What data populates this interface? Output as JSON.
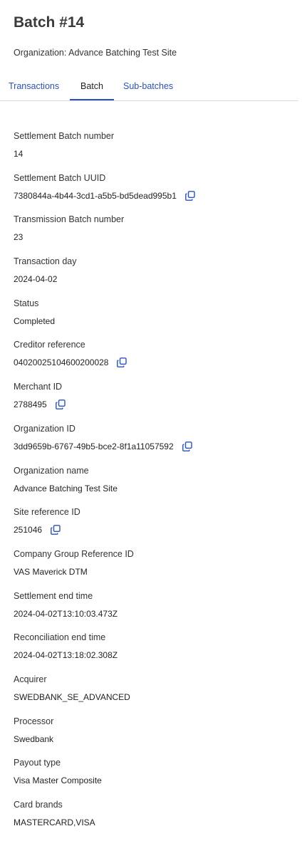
{
  "header": {
    "title": "Batch #14",
    "organization": "Organization: Advance Batching Test Site"
  },
  "tabs": [
    {
      "label": "Transactions",
      "active": false
    },
    {
      "label": "Batch",
      "active": true
    },
    {
      "label": "Sub-batches",
      "active": false
    }
  ],
  "accent_color": "#2a52be",
  "fields": {
    "settlement_batch_number": {
      "label": "Settlement Batch number",
      "value": "14"
    },
    "settlement_batch_uuid": {
      "label": "Settlement Batch UUID",
      "value": "7380844a-4b44-3cd1-a5b5-bd5dead995b1",
      "copy_icon": "copy-icon"
    },
    "transmission_batch_number": {
      "label": "Transmission Batch number",
      "value": "23"
    },
    "transaction_day": {
      "label": "Transaction day",
      "value": "2024-04-02"
    },
    "status": {
      "label": "Status",
      "value": "Completed"
    },
    "creditor_reference": {
      "label": "Creditor reference",
      "value": "04020025104600200028",
      "copy_icon": "copy-icon"
    },
    "merchant_id": {
      "label": "Merchant ID",
      "value": "2788495",
      "copy_icon": "copy-icon"
    },
    "organization_id": {
      "label": "Organization ID",
      "value": "3dd9659b-6767-49b5-bce2-8f1a11057592",
      "copy_icon": "copy-icon"
    },
    "organization_name": {
      "label": "Organization name",
      "value": "Advance Batching Test Site"
    },
    "site_reference_id": {
      "label": "Site reference ID",
      "value": "251046",
      "copy_icon": "copy-icon"
    },
    "company_group_reference_id": {
      "label": "Company Group Reference ID",
      "value": "VAS Maverick DTM"
    },
    "settlement_end_time": {
      "label": "Settlement end time",
      "value": "2024-04-02T13:10:03.473Z"
    },
    "reconciliation_end_time": {
      "label": "Reconciliation end time",
      "value": "2024-04-02T13:18:02.308Z"
    },
    "acquirer": {
      "label": "Acquirer",
      "value": "SWEDBANK_SE_ADVANCED"
    },
    "processor": {
      "label": "Processor",
      "value": "Swedbank"
    },
    "payout_type": {
      "label": "Payout type",
      "value": "Visa Master Composite"
    },
    "card_brands": {
      "label": "Card brands",
      "value": "MASTERCARD,VISA"
    }
  }
}
